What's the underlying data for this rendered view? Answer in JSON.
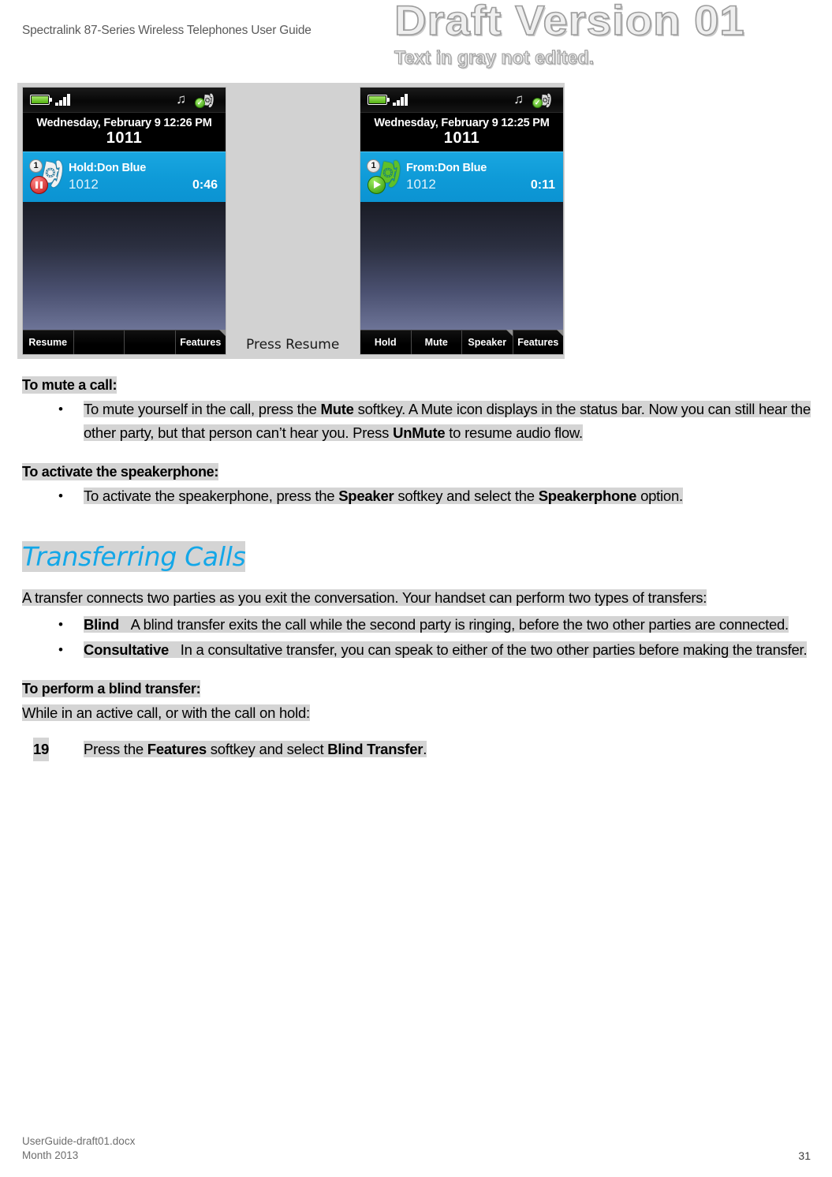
{
  "header": {
    "doc_title": "Spectralink 87-Series Wireless Telephones User Guide"
  },
  "watermark": {
    "line1": "Draft Version 01",
    "line2": "Text in gray not edited."
  },
  "figure": {
    "caption_between": "Press Resume",
    "phone_left": {
      "status": {
        "battery_icon": "battery-full-icon",
        "signal_icon": "signal-bars-icon",
        "music_icon": "music-note-icon",
        "call-state-icon": "handset-check-icon"
      },
      "date_time": "Wednesday, February 9 12:26 PM",
      "extension": "1011",
      "call": {
        "badge": "1",
        "state_icon": "call-on-hold-icon",
        "name": "Hold:Don Blue",
        "number": "1012",
        "duration": "0:46"
      },
      "softkeys": [
        "Resume",
        "",
        "",
        "Features"
      ]
    },
    "phone_right": {
      "status": {
        "battery_icon": "battery-full-icon",
        "signal_icon": "signal-bars-icon",
        "music_icon": "music-note-icon",
        "call-state-icon": "handset-check-icon"
      },
      "date_time": "Wednesday, February 9 12:25 PM",
      "extension": "1011",
      "call": {
        "badge": "1",
        "state_icon": "call-active-icon",
        "name": "From:Don Blue",
        "number": "1012",
        "duration": "0:11"
      },
      "softkeys": [
        "Hold",
        "Mute",
        "Speaker",
        "Features"
      ]
    }
  },
  "sections": {
    "mute": {
      "heading": "To mute a call:",
      "bullet_1": {
        "p1": "To mute yourself in the call, press the ",
        "b1": "Mute",
        "p2": " softkey. A Mute icon displays in the status bar. Now you can still hear the other party, but that person can’t hear you. Press ",
        "b2": "UnMute",
        "p3": " to resume audio flow."
      }
    },
    "speakerphone": {
      "heading": "To activate the speakerphone:",
      "bullet_1": {
        "p1": "To activate the speakerphone, press the ",
        "b1": "Speaker",
        "p2": " softkey and select the ",
        "b2": "Speakerphone",
        "p3": " option."
      }
    },
    "transferring": {
      "chapter_title": "Transferring Calls",
      "intro": "A transfer connects two parties as you exit the conversation. Your handset can perform two types of transfers:",
      "bullets": [
        {
          "term": "Blind",
          "text": "A blind transfer exits the call while the second party is ringing, before the two other parties are connected."
        },
        {
          "term": "Consultative",
          "text": "In a consultative transfer, you can speak to either of the two other parties before making the transfer."
        }
      ],
      "blind_heading": "To perform a blind transfer:",
      "blind_lead": "While in an active call, or with the call on hold:",
      "step": {
        "number": "19",
        "p1": "Press the ",
        "b1": "Features",
        "p2": " softkey and select ",
        "b2": "Blind Transfer",
        "p3": "."
      }
    }
  },
  "footer": {
    "file_name": "UserGuide-draft01.docx",
    "date": "Month 2013",
    "page_number": "31"
  },
  "colors": {
    "chapter_heading": "#13a7e8",
    "highlight": "#d4d4d4",
    "call_row": "#0f9bd8"
  }
}
